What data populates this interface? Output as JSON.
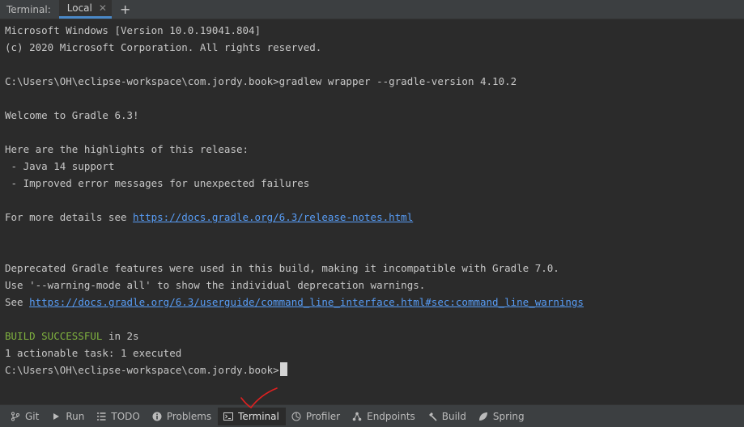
{
  "tabbar": {
    "label": "Terminal:",
    "tab_label": "Local",
    "close_glyph": "✕",
    "add_glyph": "+"
  },
  "console": {
    "lines": [
      {
        "text": "Microsoft Windows [Version 10.0.19041.804]"
      },
      {
        "text": "(c) 2020 Microsoft Corporation. All rights reserved."
      },
      {
        "text": ""
      },
      {
        "text": "C:\\Users\\OH\\eclipse-workspace\\com.jordy.book>gradlew wrapper --gradle-version 4.10.2"
      },
      {
        "text": ""
      },
      {
        "text": "Welcome to Gradle 6.3!"
      },
      {
        "text": ""
      },
      {
        "text": "Here are the highlights of this release:"
      },
      {
        "text": " - Java 14 support"
      },
      {
        "text": " - Improved error messages for unexpected failures"
      },
      {
        "text": ""
      },
      {
        "prefix": "For more details see ",
        "link": "https://docs.gradle.org/6.3/release-notes.html"
      },
      {
        "text": ""
      },
      {
        "text": ""
      },
      {
        "text": "Deprecated Gradle features were used in this build, making it incompatible with Gradle 7.0."
      },
      {
        "text": "Use '--warning-mode all' to show the individual deprecation warnings."
      },
      {
        "prefix": "See ",
        "link": "https://docs.gradle.org/6.3/userguide/command_line_interface.html#sec:command_line_warnings"
      },
      {
        "text": ""
      },
      {
        "success": "BUILD SUCCESSFUL",
        "suffix": " in 2s"
      },
      {
        "text": "1 actionable task: 1 executed"
      },
      {
        "prompt": "C:\\Users\\OH\\eclipse-workspace\\com.jordy.book>"
      }
    ]
  },
  "toolwindows": [
    {
      "name": "git",
      "label": "Git",
      "icon": "git-branch-icon"
    },
    {
      "name": "run",
      "label": "Run",
      "icon": "play-icon"
    },
    {
      "name": "todo",
      "label": "TODO",
      "icon": "list-icon"
    },
    {
      "name": "problems",
      "label": "Problems",
      "icon": "info-icon"
    },
    {
      "name": "terminal",
      "label": "Terminal",
      "icon": "terminal-icon",
      "active": true
    },
    {
      "name": "profiler",
      "label": "Profiler",
      "icon": "profiler-icon"
    },
    {
      "name": "endpoints",
      "label": "Endpoints",
      "icon": "endpoints-icon"
    },
    {
      "name": "build",
      "label": "Build",
      "icon": "hammer-icon"
    },
    {
      "name": "spring",
      "label": "Spring",
      "icon": "spring-leaf-icon"
    }
  ],
  "colors": {
    "link": "#589df6",
    "success": "#7fb13f",
    "annotation": "#e02020"
  }
}
